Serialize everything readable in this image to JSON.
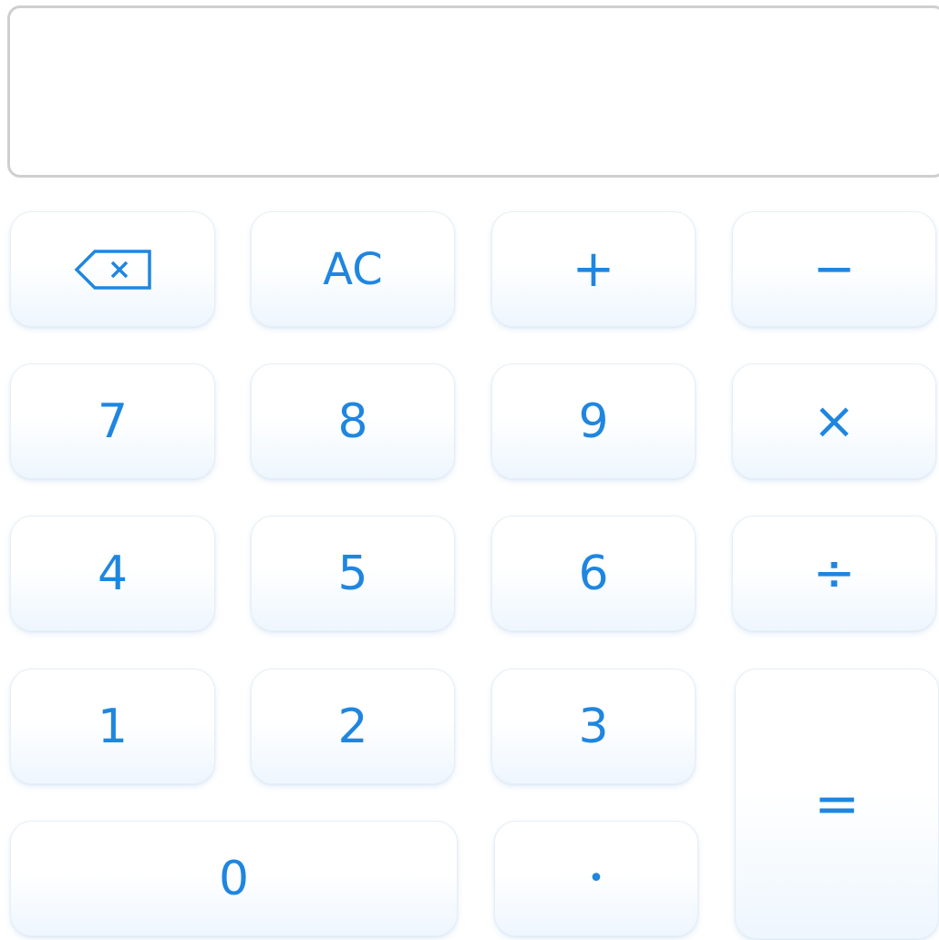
{
  "display": {
    "value": ""
  },
  "keys": {
    "backspace": {
      "icon": "backspace-icon"
    },
    "clear": "AC",
    "plus": "+",
    "minus": "−",
    "seven": "7",
    "eight": "8",
    "nine": "9",
    "multiply": "×",
    "four": "4",
    "five": "5",
    "six": "6",
    "divide": "÷",
    "one": "1",
    "two": "2",
    "three": "3",
    "equals": "=",
    "zero": "0",
    "decimal": "•"
  },
  "colors": {
    "key_text": "#1f86e0",
    "display_border": "#cfcfcf",
    "key_gradient_bottom": "#eef6fe"
  }
}
